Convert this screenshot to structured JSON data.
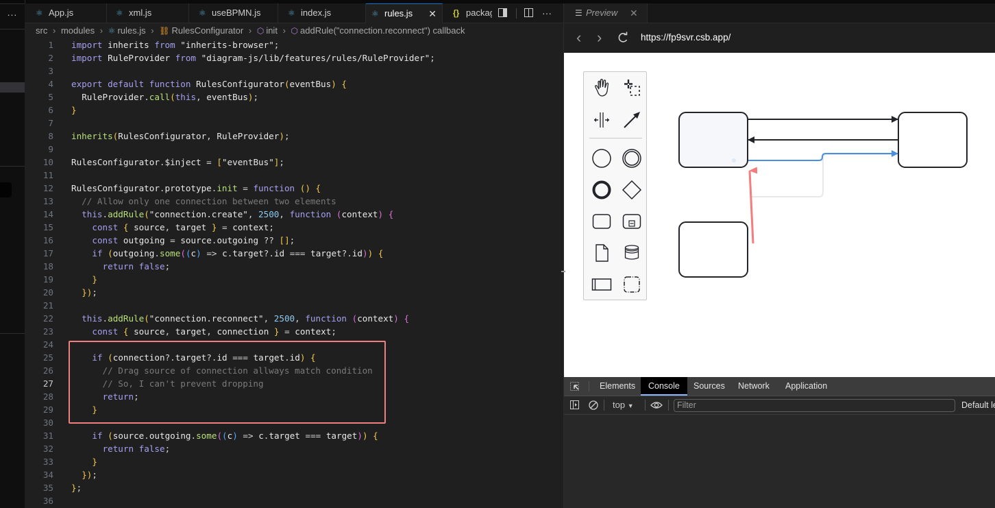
{
  "sidebar": {
    "more_label": "..."
  },
  "editor_tabs": [
    {
      "label": "App.js",
      "icon": "react-icon",
      "active": false
    },
    {
      "label": "xml.js",
      "icon": "react-icon",
      "active": false
    },
    {
      "label": "useBPMN.js",
      "icon": "react-icon",
      "active": false
    },
    {
      "label": "index.js",
      "icon": "react-icon",
      "active": false
    },
    {
      "label": "rules.js",
      "icon": "react-icon",
      "active": true
    },
    {
      "label": "packag",
      "icon": "json-icon",
      "active": false
    }
  ],
  "tab_close_glyph": "✕",
  "editor_actions": {
    "toggle_preview": "toggle-panel-icon",
    "split": "split-editor-icon",
    "more": "···"
  },
  "breadcrumb": [
    {
      "label": "src",
      "icon": null
    },
    {
      "label": "modules",
      "icon": null
    },
    {
      "label": "rules.js",
      "icon": "react-icon"
    },
    {
      "label": "RulesConfigurator",
      "icon": "class-icon"
    },
    {
      "label": "init",
      "icon": "method-icon"
    },
    {
      "label": "addRule(\"connection.reconnect\") callback",
      "icon": "method-icon"
    }
  ],
  "code": {
    "current_line": 27,
    "lines": [
      "import inherits from \"inherits-browser\";",
      "import RuleProvider from \"diagram-js/lib/features/rules/RuleProvider\";",
      "",
      "export default function RulesConfigurator(eventBus) {",
      "  RuleProvider.call(this, eventBus);",
      "}",
      "",
      "inherits(RulesConfigurator, RuleProvider);",
      "",
      "RulesConfigurator.$inject = [\"eventBus\"];",
      "",
      "RulesConfigurator.prototype.init = function () {",
      "  // Allow only one connection between two elements",
      "  this.addRule(\"connection.create\", 2500, function (context) {",
      "    const { source, target } = context;",
      "    const outgoing = source.outgoing ?? [];",
      "    if (outgoing.some((c) => c.target?.id === target?.id)) {",
      "      return false;",
      "    }",
      "  });",
      "",
      "  this.addRule(\"connection.reconnect\", 2500, function (context) {",
      "    const { source, target, connection } = context;",
      "",
      "    if (connection?.target?.id === target.id) {",
      "      // Drag source of connection allways match condition",
      "      // So, I can't prevent dropping",
      "      return;",
      "    }",
      "",
      "    if (source.outgoing.some((c) => c.target === target)) {",
      "      return false;",
      "    }",
      "  });",
      "};",
      ""
    ]
  },
  "highlight": {
    "from_line": 24,
    "to_line": 30,
    "color": "#f07f7f"
  },
  "preview": {
    "tab_label": "Preview",
    "url": "https://fp9svr.csb.app/",
    "nav": {
      "back": "‹",
      "forward": "›",
      "reload": "⟳"
    },
    "palette_tools": [
      "hand-tool",
      "lasso-tool",
      "space-tool",
      "global-connect-tool",
      "start-event",
      "intermediate-event",
      "end-event",
      "gateway",
      "task",
      "subprocess",
      "data-object",
      "data-store",
      "pool",
      "group"
    ],
    "diagram": {
      "colors": {
        "stroke": "#22242a",
        "selected_fill": "#f5f7fa",
        "blue": "#4a90e2",
        "red_arrow": "#f47c7c",
        "ghost": "#e8e8e8"
      }
    }
  },
  "devtools": {
    "tabs": [
      "Elements",
      "Console",
      "Sources",
      "Network",
      "Application"
    ],
    "active_tab": "Console",
    "context": "top",
    "filter_placeholder": "Filter",
    "levels_label": "Default le"
  }
}
